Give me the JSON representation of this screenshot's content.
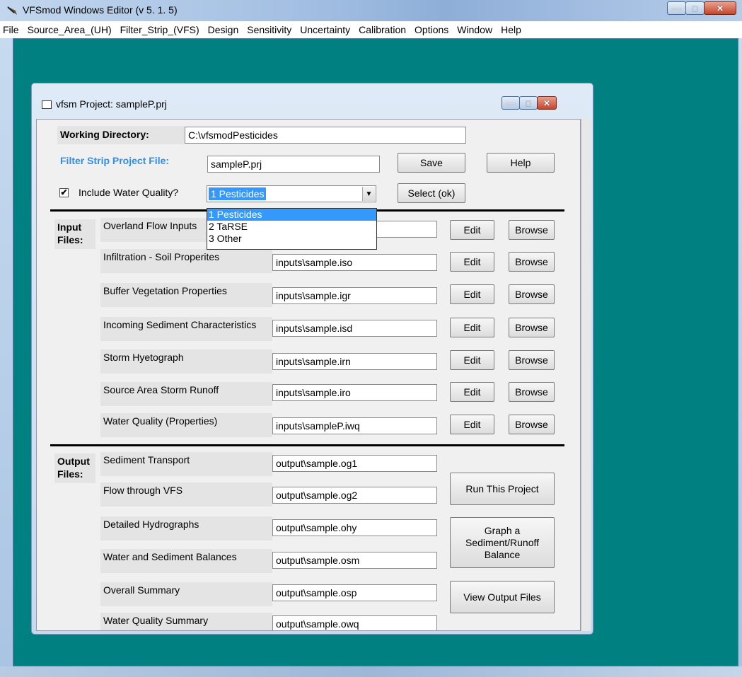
{
  "window": {
    "title": "VFSmod Windows Editor (v 5. 1. 5)"
  },
  "menu": [
    "File",
    "Source_Area_(UH)",
    "Filter_Strip_(VFS)",
    "Design",
    "Sensitivity",
    "Uncertainty",
    "Calibration",
    "Options",
    "Window",
    "Help"
  ],
  "project_window": {
    "title": "vfsm Project: sampleP.prj"
  },
  "top": {
    "working_dir_label": "Working Directory:",
    "working_dir_value": "C:\\vfsmodPesticides",
    "project_file_label": "Filter Strip Project File:",
    "project_file_value": "sampleP.prj",
    "save_label": "Save",
    "help_label": "Help",
    "water_quality_checkbox": "✔",
    "water_quality_label": "Include Water Quality?",
    "water_quality_selected": "1 Pesticides",
    "select_ok_label": "Select (ok)",
    "options": [
      "1 Pesticides",
      "2 TaRSE",
      "3 Other"
    ]
  },
  "inputs": {
    "section_label_1": "Input",
    "section_label_2": "Files:",
    "edit_label": "Edit",
    "browse_label": "Browse",
    "rows": [
      {
        "label": "Overland Flow Inputs",
        "value": ""
      },
      {
        "label": "Infiltration - Soil Properites",
        "value": "inputs\\sample.iso"
      },
      {
        "label": "Buffer Vegetation Properties",
        "value": "inputs\\sample.igr"
      },
      {
        "label": "Incoming Sediment Characteristics",
        "value": "inputs\\sample.isd"
      },
      {
        "label": "Storm Hyetograph",
        "value": "inputs\\sample.irn"
      },
      {
        "label": "Source Area Storm Runoff",
        "value": "inputs\\sample.iro"
      },
      {
        "label": "Water Quality (Properties)",
        "value": "inputs\\sampleP.iwq"
      }
    ]
  },
  "outputs": {
    "section_label_1": "Output",
    "section_label_2": "Files:",
    "rows": [
      {
        "label": "Sediment Transport",
        "value": "output\\sample.og1"
      },
      {
        "label": "Flow through VFS",
        "value": "output\\sample.og2"
      },
      {
        "label": "Detailed Hydrographs",
        "value": "output\\sample.ohy"
      },
      {
        "label": "Water and Sediment Balances",
        "value": "output\\sample.osm"
      },
      {
        "label": "Overall Summary",
        "value": "output\\sample.osp"
      },
      {
        "label": "Water Quality Summary",
        "value": "output\\sample.owq"
      }
    ],
    "run_label": "Run This Project",
    "graph_label_1": "Graph a",
    "graph_label_2": "Sediment/Runoff",
    "graph_label_3": "Balance",
    "view_label": "View Output Files"
  },
  "colors": {
    "mdi_background": "#008080",
    "selection": "#3399ff",
    "blue_label": "#2f8fe8"
  }
}
